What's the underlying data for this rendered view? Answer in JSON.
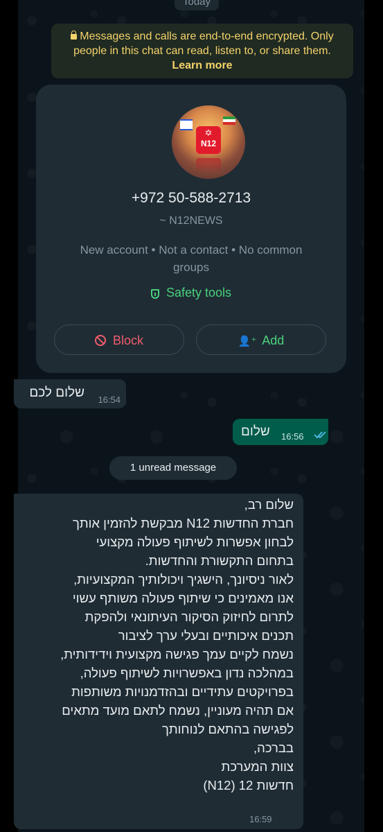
{
  "date_chip": "Today",
  "encryption_notice": {
    "text": "Messages and calls are end-to-end encrypted. Only people in this chat can read, listen to, or share them.",
    "link": "Learn more"
  },
  "contact_card": {
    "avatar_text": "N12",
    "phone": "+972 50-588-2713",
    "pushname": "~ N12NEWS",
    "meta": "New account • Not a contact • No common groups",
    "safety_tools": "Safety tools",
    "block_label": "Block",
    "add_label": "Add"
  },
  "messages": [
    {
      "direction": "incoming",
      "text": "שלום לכם",
      "time": "16:54"
    },
    {
      "direction": "outgoing",
      "text": "שלום",
      "time": "16:56",
      "status": "read"
    },
    {
      "direction": "incoming",
      "text": "שלום רב,\nחברת החדשות N12 מבקשת להזמין אותך\nלבחון אפשרות לשיתוף פעולה מקצועי\nבתחום התקשורת והחדשות.\nלאור ניסיונך, הישגיך ויכולותיך המקצועיות,\nאנו מאמינים כי שיתוף פעולה משותף עשוי\nלתרום לחיזוק הסיקור העיתונאי ולהפקת\nתכנים איכותיים ובעלי ערך לציבור\nנשמח לקיים עמך פגישה מקצועית וידידותית,\nבמהלכה נדון באפשרויות לשיתוף פעולה,\nבפרויקטים עתידיים ובהזדמנויות משותפות\nאם תהיה מעוניין, נשמח לתאם מועד מתאים\nלפגישה בהתאם לנוחותך\nבברכה,\nצוות המערכת\nחדשות 12 (N12)",
      "time": "16:59"
    }
  ],
  "unread_divider": "1 unread message",
  "colors": {
    "chat_background": "#0b141a",
    "incoming_bubble": "#1f2c34",
    "outgoing_bubble": "#005c4b",
    "encryption_text": "#f5d36b",
    "accent_green": "#4ad17c",
    "block_red": "#f15c6d",
    "read_ticks": "#53bdeb"
  }
}
